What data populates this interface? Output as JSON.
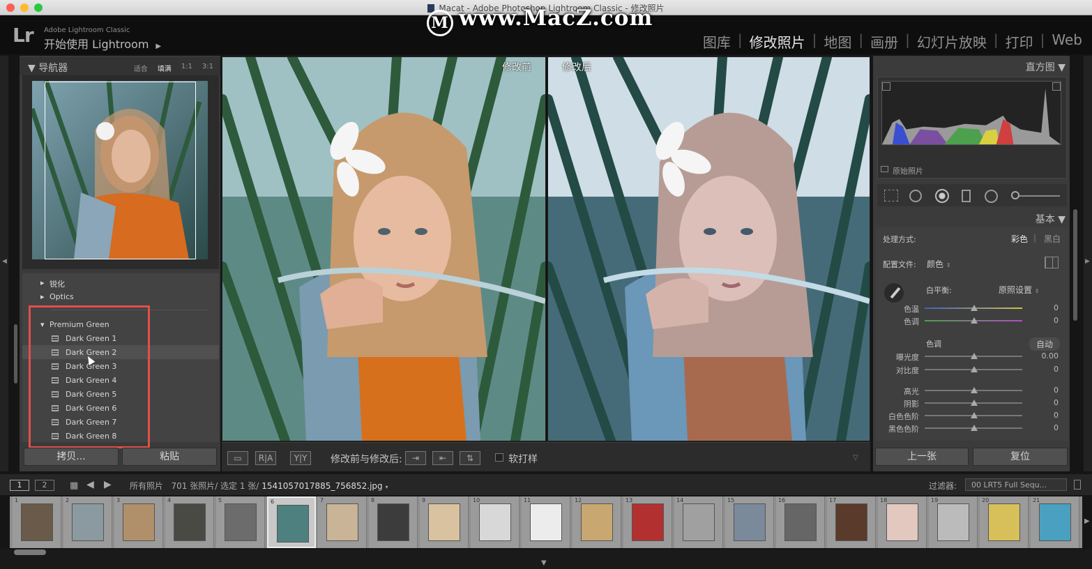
{
  "window": {
    "title": "Macat - Adobe Photoshop Lightroom Classic - 修改照片",
    "watermark": "www.MacZ.com",
    "watermark_logo": "M"
  },
  "header": {
    "logo": "Lr",
    "brand_line1": "Adobe Lightroom Classic",
    "brand_line2": "开始使用 Lightroom",
    "modules": [
      "图库",
      "修改照片",
      "地图",
      "画册",
      "幻灯片放映",
      "打印",
      "Web"
    ],
    "active_module": "修改照片"
  },
  "navigator": {
    "title": "导航器",
    "zoom_options": [
      "适合",
      "填满",
      "1:1",
      "3:1"
    ],
    "active_zoom": "填满"
  },
  "presets": {
    "collapsed_groups": [
      "锐化",
      "Optics"
    ],
    "open_group": "Premium Green",
    "items": [
      "Dark Green 1",
      "Dark Green 2",
      "Dark Green 3",
      "Dark Green 4",
      "Dark Green 5",
      "Dark Green 6",
      "Dark Green 7",
      "Dark Green 8"
    ],
    "hovered_item": "Dark Green 2"
  },
  "left_buttons": {
    "copy": "拷贝...",
    "paste": "粘贴"
  },
  "view": {
    "before_label": "修改前",
    "after_label": "修改后"
  },
  "toolbar": {
    "compare_label": "修改前与修改后:",
    "softproof_label": "软打样",
    "btn_ra": "R|A",
    "btn_yy": "Y|Y"
  },
  "histogram": {
    "title": "直方图",
    "original_photo": "原始照片"
  },
  "basic": {
    "title": "基本",
    "treatment_label": "处理方式:",
    "treatment_color": "彩色",
    "treatment_bw": "黑白",
    "profile_label": "配置文件:",
    "profile_value": "颜色",
    "wb_label": "白平衡:",
    "wb_value": "原照设置",
    "tone_label": "色调",
    "auto_label": "自动",
    "sliders": [
      {
        "label": "色温",
        "value": "0"
      },
      {
        "label": "色调",
        "value": "0"
      },
      {
        "label": "曝光度",
        "value": "0.00"
      },
      {
        "label": "对比度",
        "value": "0"
      },
      {
        "label": "高光",
        "value": "0"
      },
      {
        "label": "阴影",
        "value": "0"
      },
      {
        "label": "白色色阶",
        "value": "0"
      },
      {
        "label": "黑色色阶",
        "value": "0"
      }
    ]
  },
  "right_buttons": {
    "prev": "上一张",
    "reset": "复位"
  },
  "filmbar": {
    "page1": "1",
    "page2": "2",
    "source": "所有照片",
    "info_prefix": "701 张照片/ 选定 1 张/",
    "filename": "1541057017885_756852.jpg",
    "filter_label": "过滤器:",
    "filter_value": "00 LRT5 Full Sequ..."
  },
  "filmstrip": {
    "numbers": [
      "1",
      "2",
      "3",
      "4",
      "5",
      "6",
      "7",
      "8",
      "9",
      "10",
      "11",
      "12",
      "13",
      "14",
      "15",
      "16",
      "17",
      "18",
      "19",
      "20",
      "21"
    ],
    "selected_index": 6
  },
  "colors": {
    "accent_red": "#e0504a",
    "panel_bg": "#3a3a3a",
    "active_module": "#e6e6e6"
  }
}
